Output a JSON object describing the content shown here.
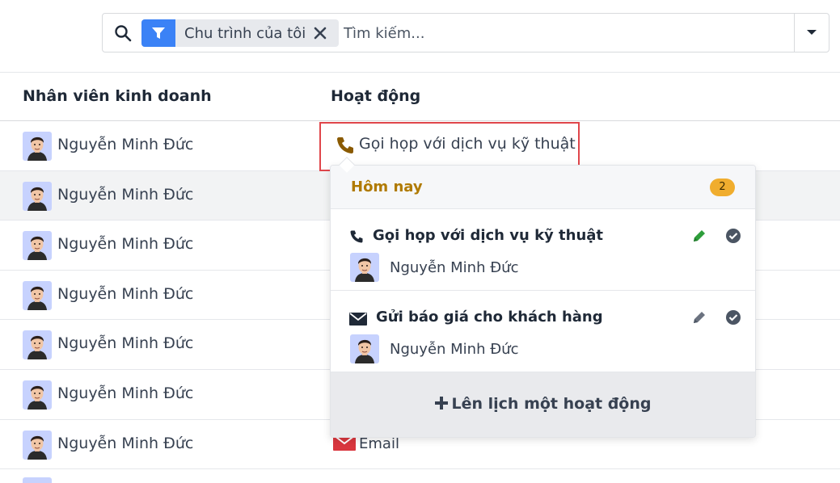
{
  "search": {
    "facet_label": "Chu trình của tôi",
    "placeholder": "Tìm kiếm..."
  },
  "table": {
    "columns": [
      "Nhân viên kinh doanh",
      "Hoạt động"
    ],
    "rows": [
      {
        "salesperson": "Nguyễn Minh Đức",
        "activity": "Gọi họp với dịch vụ kỹ thuật"
      },
      {
        "salesperson": "Nguyễn Minh Đức",
        "activity": ""
      },
      {
        "salesperson": "Nguyễn Minh Đức",
        "activity": ""
      },
      {
        "salesperson": "Nguyễn Minh Đức",
        "activity": ""
      },
      {
        "salesperson": "Nguyễn Minh Đức",
        "activity": ""
      },
      {
        "salesperson": "Nguyễn Minh Đức",
        "activity": ""
      },
      {
        "salesperson": "Nguyễn Minh Đức",
        "activity": "Email"
      }
    ]
  },
  "popover": {
    "section_title": "Hôm nay",
    "count": "2",
    "items": [
      {
        "title": "Gọi họp với dịch vụ kỹ thuật",
        "icon": "phone-icon",
        "user": "Nguyễn Minh Đức"
      },
      {
        "title": "Gửi báo giá cho khách hàng",
        "icon": "envelope-icon",
        "user": "Nguyễn Minh Đức"
      }
    ],
    "schedule_label": "Lên lịch một hoạt động"
  },
  "colors": {
    "accent_blue": "#3b82f6",
    "highlight_red": "#e0464b",
    "today_gold": "#b07a00",
    "badge_orange": "#f0ad2e",
    "edit_green": "#2e9e3b",
    "phone_brown": "#8a5a00",
    "email_red": "#d9363e"
  }
}
